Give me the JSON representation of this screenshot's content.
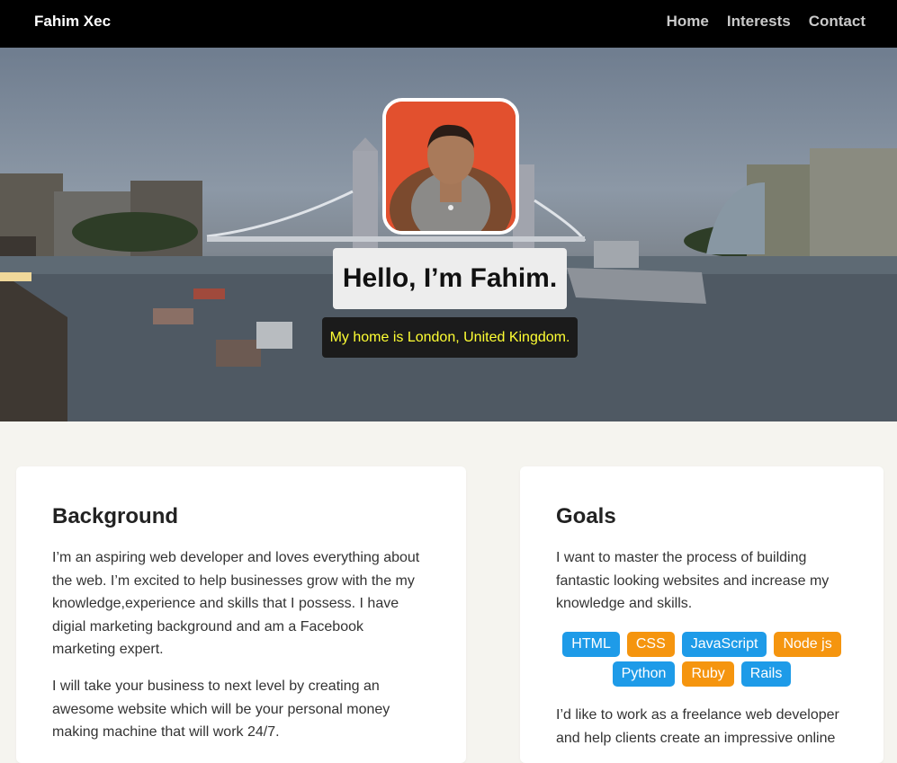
{
  "nav": {
    "brand": "Fahim Xec",
    "links": [
      "Home",
      "Interests",
      "Contact"
    ]
  },
  "hero": {
    "title": "Hello, I’m Fahim.",
    "subtitle": "My home is London, United Kingdom."
  },
  "background": {
    "heading": "Background",
    "p1": "I’m an aspiring web developer and loves everything about the web. I’m excited to help businesses grow with the my knowledge,experience and skills that I possess. I have digial marketing background and am a Facebook marketing expert.",
    "p2": "I will take your business to next level by creating an awesome website which will be your personal money making machine that will work 24/7."
  },
  "goals": {
    "heading": "Goals",
    "p1": "I want to master the process of building fantastic looking websites and increase my knowledge and skills.",
    "tags": [
      {
        "label": "HTML",
        "color": "#1e9be8"
      },
      {
        "label": "CSS",
        "color": "#f5950f"
      },
      {
        "label": "JavaScript",
        "color": "#1e9be8"
      },
      {
        "label": "Node js",
        "color": "#f5950f"
      },
      {
        "label": "Python",
        "color": "#1e9be8"
      },
      {
        "label": "Ruby",
        "color": "#f5950f"
      },
      {
        "label": "Rails",
        "color": "#1e9be8"
      }
    ],
    "p2": "I’d like to work as a freelance web developer and help clients create an impressive online"
  },
  "colors": {
    "nav_bg": "#000000",
    "page_bg": "#f5f4ef",
    "tag_blue": "#1e9be8",
    "tag_orange": "#f5950f",
    "subtitle_text": "#ffff33"
  }
}
